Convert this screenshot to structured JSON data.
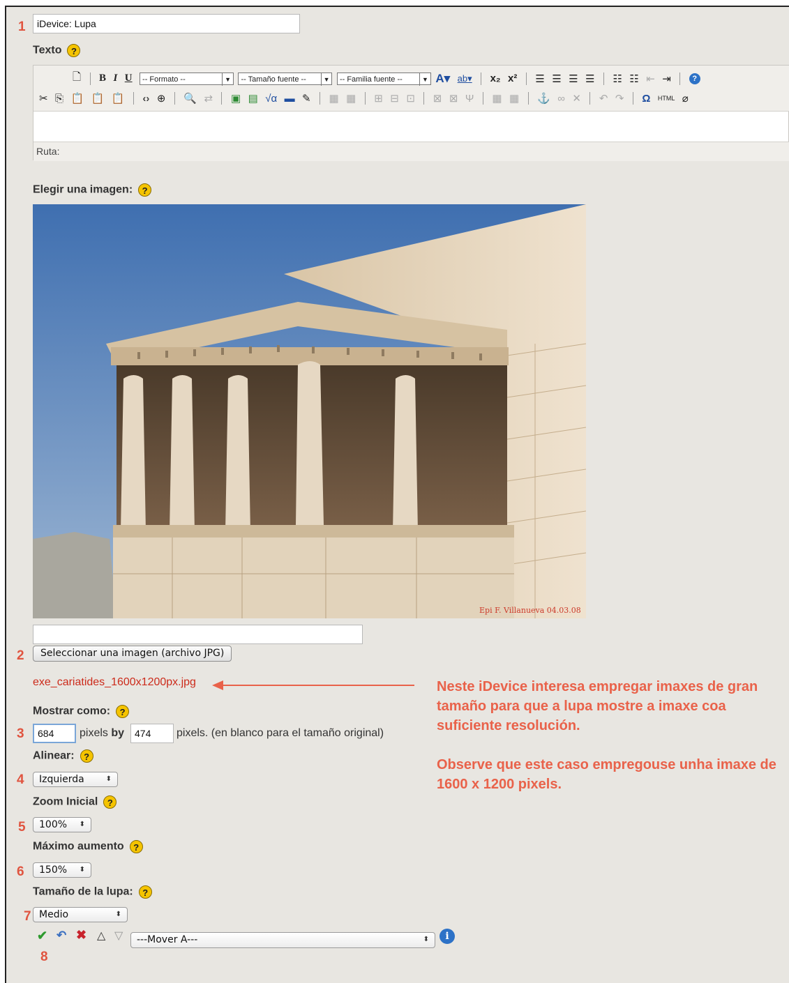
{
  "step_numbers": [
    "1",
    "2",
    "3",
    "4",
    "5",
    "6",
    "7",
    "8"
  ],
  "title_field": {
    "value": "iDevice: Lupa"
  },
  "texto": {
    "label": "Texto",
    "help": "?",
    "toolbar1": {
      "buttons": [
        "new-document-icon",
        "bold-icon",
        "italic-icon",
        "underline-icon"
      ],
      "bold": "B",
      "italic": "I",
      "underline": "U",
      "formato": "-- Formato --",
      "tamano": "-- Tamaño fuente --",
      "familia": "-- Familia fuente --",
      "font_color": "A",
      "highlight": "ab",
      "subscript": "x₂",
      "superscript": "x²",
      "help_circle": "?"
    },
    "ruta_label": "Ruta:"
  },
  "image_section": {
    "label": "Elegir una imagen:",
    "help": "?",
    "image_caption": "Epi F. Villanueva 04.03.08",
    "file_path": "",
    "select_button": "Seleccionar una imagen (archivo JPG)",
    "filename": "exe_cariatides_1600x1200px.jpg"
  },
  "mostrar": {
    "label": "Mostrar como:",
    "help": "?",
    "width": "684",
    "pixels_by": "pixels",
    "by": "by",
    "height": "474",
    "suffix": "pixels. (en blanco para el tamaño original)"
  },
  "alinear": {
    "label": "Alinear:",
    "help": "?",
    "value": "Izquierda"
  },
  "zoom": {
    "label": "Zoom Inicial",
    "help": "?",
    "value": "100%"
  },
  "maximo": {
    "label": "Máximo aumento",
    "help": "?",
    "value": "150%"
  },
  "tamano_lupa": {
    "label": "Tamaño de la lupa:",
    "help": "?",
    "value": "Medio"
  },
  "actions": {
    "mover": "---Mover A---",
    "info": "i"
  },
  "annotation": {
    "line1": "Neste iDevice interesa empregar imaxes de gran tamaño para que a lupa mostre a imaxe coa suficiente resolución.",
    "line2": "Observe que este caso empregouse unha imaxe de 1600 x 1200 pixels."
  },
  "colors": {
    "annotation": "#e9624a",
    "background": "#e8e6e1",
    "help_icon": "#f5c400"
  }
}
